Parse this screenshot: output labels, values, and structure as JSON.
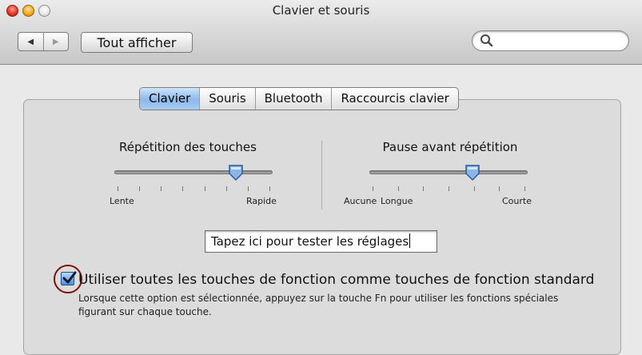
{
  "window": {
    "title": "Clavier et souris"
  },
  "toolbar": {
    "back_glyph": "◀",
    "forward_glyph": "▶",
    "show_all_label": "Tout afficher",
    "search": {
      "value": "",
      "placeholder": ""
    }
  },
  "tabs": [
    {
      "label": "Clavier",
      "active": true
    },
    {
      "label": "Souris",
      "active": false
    },
    {
      "label": "Bluetooth",
      "active": false
    },
    {
      "label": "Raccourcis clavier",
      "active": false
    }
  ],
  "sliders": {
    "key_repeat": {
      "title": "Répétition des touches",
      "min_label": "Lente",
      "max_label": "Rapide",
      "tick_count": 8,
      "value_fraction": 0.78
    },
    "delay_until_repeat": {
      "title": "Pause avant répétition",
      "off_label": "Aucune",
      "long_label": "Longue",
      "short_label": "Courte",
      "tick_count": 7,
      "value_fraction": 0.66
    }
  },
  "test_field": {
    "value": "Tapez ici pour tester les réglages"
  },
  "fn_option": {
    "checked": true,
    "label": "Utiliser toutes les touches de fonction comme touches de fonction standard",
    "description": "Lorsque cette option est sélectionnée, appuyez sur la touche Fn pour utiliser les fonctions spéciales figurant sur chaque touche."
  },
  "colors": {
    "accent": "#8db8ea",
    "annotation_ring": "#7a1010"
  }
}
